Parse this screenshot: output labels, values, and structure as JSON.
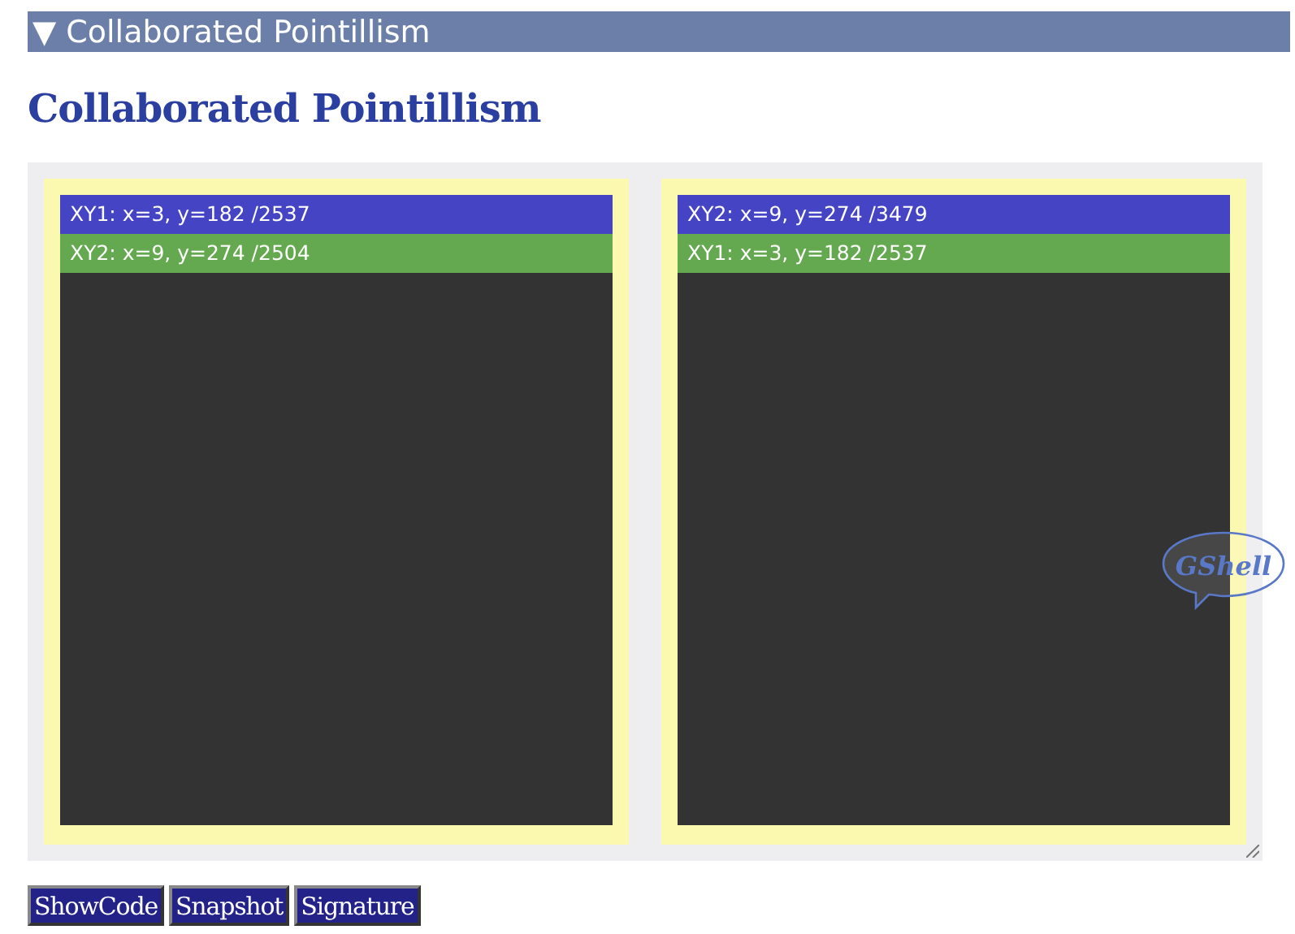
{
  "section_header": {
    "arrow": "▼",
    "title": "Collaborated Pointillism",
    "expanded": true
  },
  "heading": "Collaborated Pointillism",
  "panels": [
    {
      "rows": [
        {
          "text": "XY1: x=3, y=182 /2537",
          "color": "#4444c4"
        },
        {
          "text": "XY2: x=9, y=274 /2504",
          "color": "#64a850"
        }
      ]
    },
    {
      "rows": [
        {
          "text": "XY2: x=9, y=274 /3479",
          "color": "#4444c4"
        },
        {
          "text": "XY1: x=3, y=182 /2537",
          "color": "#64a850"
        }
      ]
    }
  ],
  "logo": "GShell",
  "buttons": [
    "ShowCode",
    "Snapshot",
    "Signature"
  ]
}
